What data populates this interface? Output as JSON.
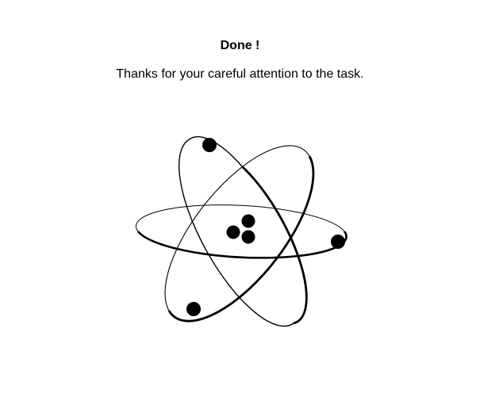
{
  "completion": {
    "title": "Done !",
    "message": "Thanks for your careful attention to the task."
  },
  "illustration": {
    "icon": "atom-icon",
    "color": "#000000"
  }
}
